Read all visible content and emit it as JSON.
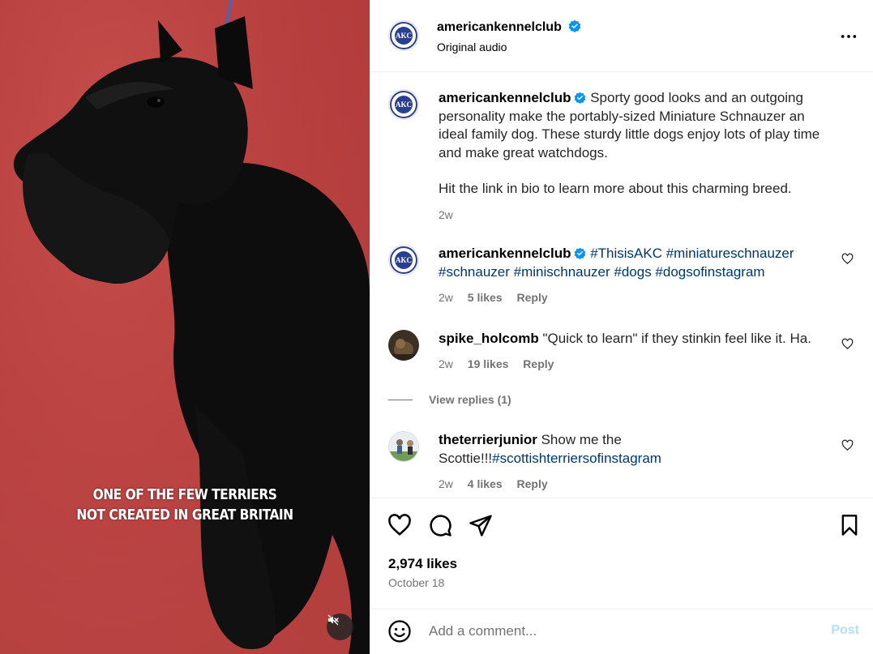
{
  "media": {
    "caption_line1": "ONE OF THE FEW TERRIERS",
    "caption_line2": "NOT CREATED IN GREAT BRITAIN",
    "mute_icon": "speaker-muted-icon"
  },
  "header": {
    "username": "americankennelclub",
    "subtitle": "Original audio",
    "avatar_text": "AKC",
    "more_icon": "more-horizontal-icon"
  },
  "caption_post": {
    "username": "americankennelclub",
    "text_part1": "Sporty good looks and an outgoing personality make the portably-sized Miniature Schnauzer an ideal family dog. These sturdy little dogs enjoy lots of play time and make great watchdogs.",
    "text_part2": "Hit the link in bio to learn more about this charming breed.",
    "time": "2w"
  },
  "comments": [
    {
      "username": "americankennelclub",
      "verified": true,
      "text": "#ThisisAKC #miniatureschnauzer #schnauzer #minischnauzer #dogs #dogsofinstagram",
      "time": "2w",
      "likes": "5 likes",
      "reply": "Reply"
    },
    {
      "username": "spike_holcomb",
      "text": "\"Quick to learn\" if they stinkin feel like it. Ha.",
      "time": "2w",
      "likes": "19 likes",
      "reply": "Reply",
      "view_replies": "View replies (1)"
    },
    {
      "username": "theterrierjunior",
      "text_plain": "Show me the Scottie!!!",
      "text_tag": "#scottishterriersofinstagram",
      "time": "2w",
      "likes": "4 likes",
      "reply": "Reply"
    }
  ],
  "actions": {
    "likes": "2,974 likes",
    "date": "October 18"
  },
  "composer": {
    "placeholder": "Add a comment...",
    "post_label": "Post"
  },
  "colors": {
    "link": "#00376b",
    "verified": "#0095f6",
    "secondary": "#737373",
    "post_disabled": "#b2dffc"
  }
}
